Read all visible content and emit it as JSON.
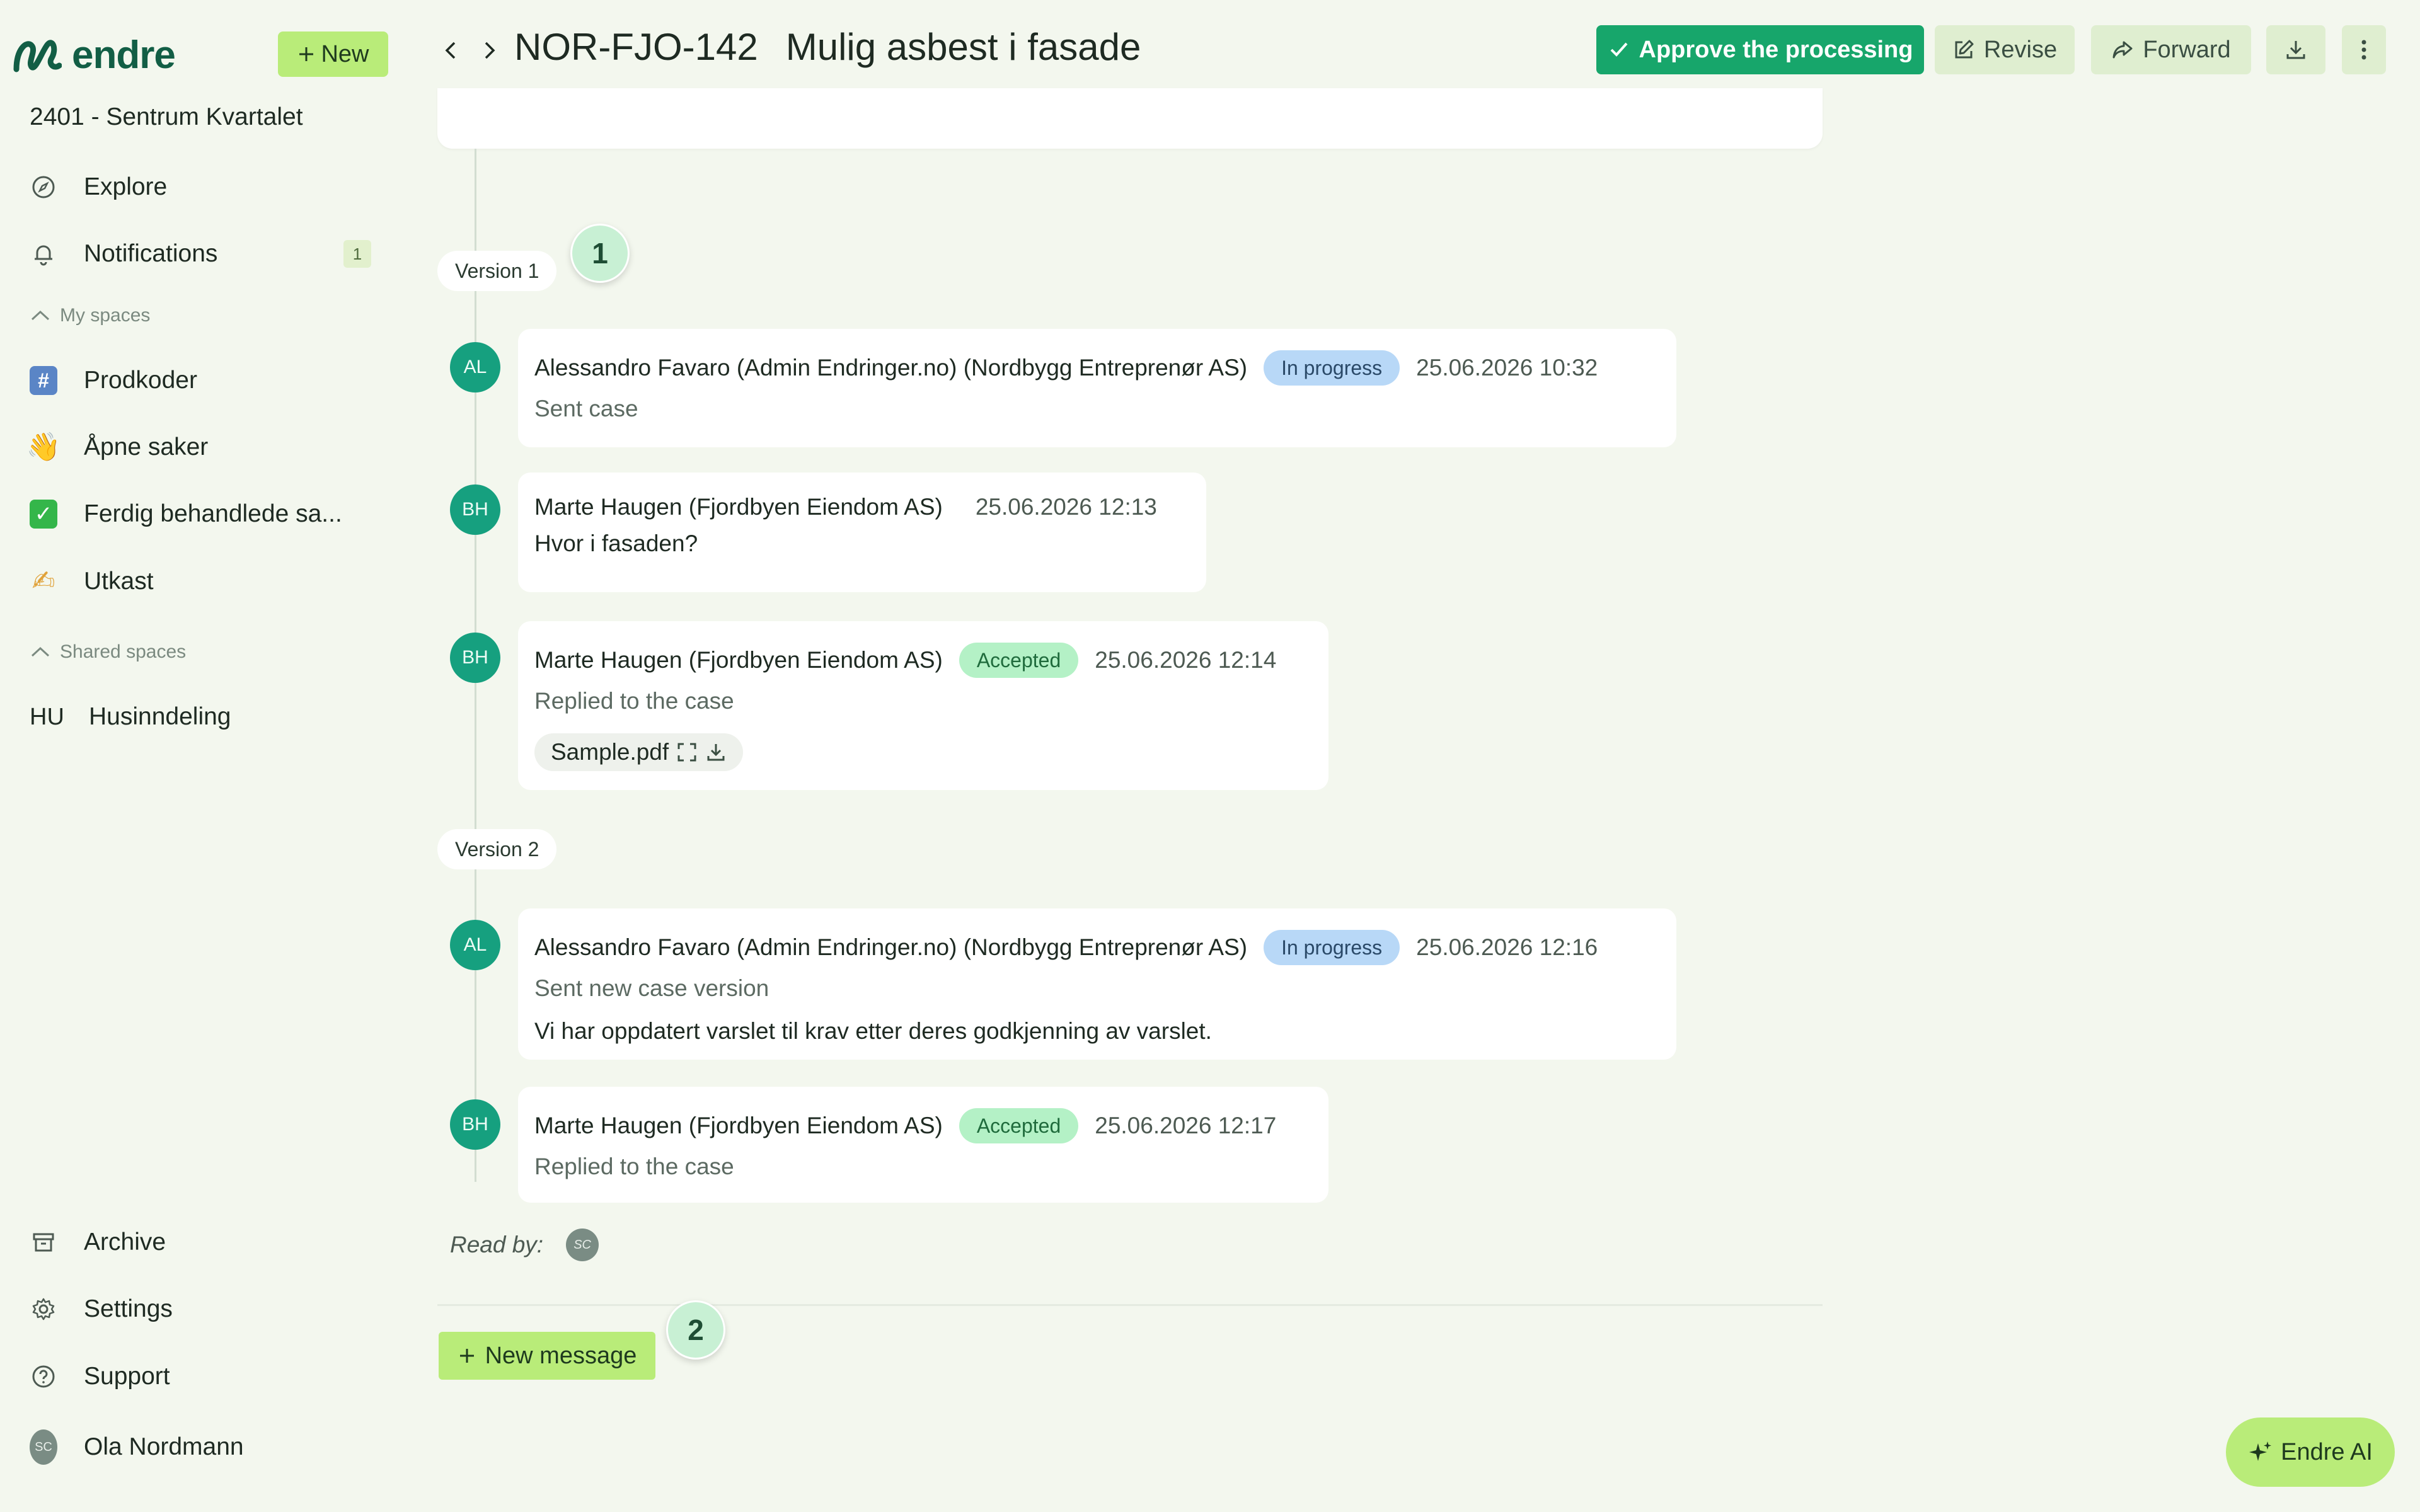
{
  "app": {
    "logo_text": "endre",
    "new_label": "New"
  },
  "sidebar": {
    "project": "2401 - Sentrum Kvartalet",
    "explore": "Explore",
    "notifications": "Notifications",
    "notifications_count": "1",
    "my_spaces_label": "My spaces",
    "my_spaces": [
      {
        "label": "Prodkoder",
        "icon": "#"
      },
      {
        "label": "Åpne saker",
        "icon": "👋"
      },
      {
        "label": "Ferdig behandlede sa...",
        "icon": "✓"
      },
      {
        "label": "Utkast",
        "icon": "✍"
      }
    ],
    "shared_spaces_label": "Shared spaces",
    "shared_spaces": [
      {
        "abbr": "HU",
        "label": "Husinndeling"
      }
    ],
    "archive": "Archive",
    "settings": "Settings",
    "support": "Support",
    "user": {
      "initials": "SC",
      "name": "Ola Nordmann"
    }
  },
  "header": {
    "case_id": "NOR-FJO-142",
    "case_title": "Mulig asbest i fasade",
    "approve_label": "Approve the processing",
    "revise_label": "Revise",
    "forward_label": "Forward"
  },
  "timeline": {
    "version1_label": "Version 1",
    "version2_label": "Version 2",
    "marker1": "1",
    "marker2": "2",
    "messages": [
      {
        "initials": "AL",
        "author": "Alessandro Favaro (Admin Endringer.no) (Nordbygg Entreprenør AS)",
        "status": "In progress",
        "date": "25.06.2026 10:32",
        "subtitle": "Sent case"
      },
      {
        "initials": "BH",
        "author": "Marte Haugen (Fjordbyen Eiendom AS)",
        "date": "25.06.2026 12:13",
        "text": "Hvor i fasaden?"
      },
      {
        "initials": "BH",
        "author": "Marte Haugen (Fjordbyen Eiendom AS)",
        "status": "Accepted",
        "date": "25.06.2026 12:14",
        "subtitle": "Replied to the case",
        "attachment": "Sample.pdf"
      },
      {
        "initials": "AL",
        "author": "Alessandro Favaro (Admin Endringer.no) (Nordbygg Entreprenør AS)",
        "status": "In progress",
        "date": "25.06.2026 12:16",
        "subtitle": "Sent new case version",
        "text": "Vi har oppdatert varslet til krav etter deres godkjenning av varslet."
      },
      {
        "initials": "BH",
        "author": "Marte Haugen (Fjordbyen Eiendom AS)",
        "status": "Accepted",
        "date": "25.06.2026 12:17",
        "subtitle": "Replied to the case"
      }
    ],
    "read_by_label": "Read by:",
    "read_by_initials": "SC",
    "new_message_label": "New message"
  },
  "ai_label": "Endre AI",
  "colors": {
    "brand": "#125e45",
    "accent_lime": "#b9ec79",
    "approve": "#17a66b",
    "avatar": "#16a07f"
  }
}
